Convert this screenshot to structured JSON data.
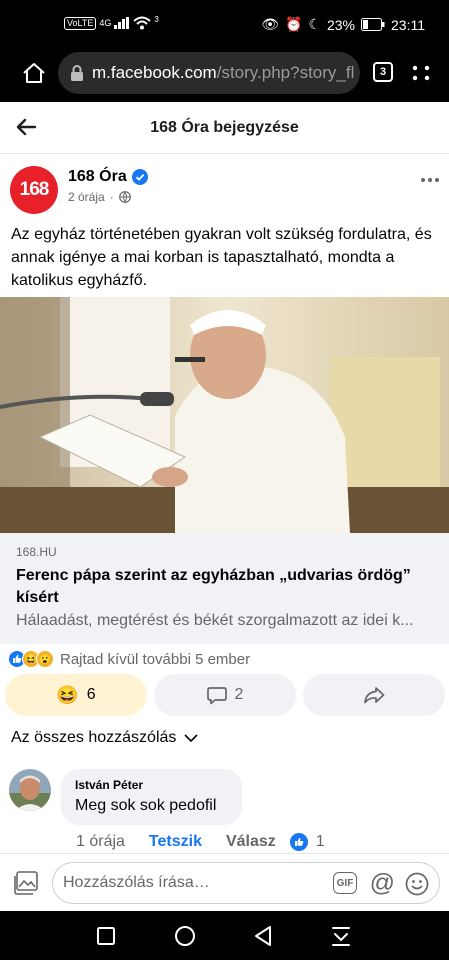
{
  "status": {
    "carrier": "VoLTE",
    "network": "4G",
    "wifi_sup": "3",
    "battery": "23%",
    "time": "23:11"
  },
  "browser": {
    "url_host": "m.facebook.com",
    "url_path": "/story.php?story_fl",
    "tab_count": "3"
  },
  "header": {
    "title": "168 Óra bejegyzése"
  },
  "post": {
    "avatar_text": "168",
    "page_name": "168 Óra",
    "time_ago": "2 órája",
    "separator": "·",
    "text": "Az egyház történetében gyakran volt szükség fordulatra, és annak igénye a mai korban is tapasztalható, mondta a katolikus egyházfő.",
    "link": {
      "domain": "168.HU",
      "headline": "Ferenc pápa szerint az egyházban „udvarias ördög” kísért",
      "description": "Hálaadást, megtérést és békét szorgalmazott az idei k..."
    },
    "reactions_text": "Rajtad kívül további 5 ember",
    "reaction_count": "6",
    "comment_count": "2"
  },
  "comments": {
    "sort_label": "Az összes hozzászólás",
    "items": [
      {
        "author": "István Péter",
        "text": "Meg sok sok pedofil",
        "time": "1 órája",
        "like_label": "Tetszik",
        "reply_label": "Válasz",
        "likes": "1"
      }
    ]
  },
  "composer": {
    "placeholder": "Hozzászólás írása…",
    "gif_label": "GIF"
  }
}
